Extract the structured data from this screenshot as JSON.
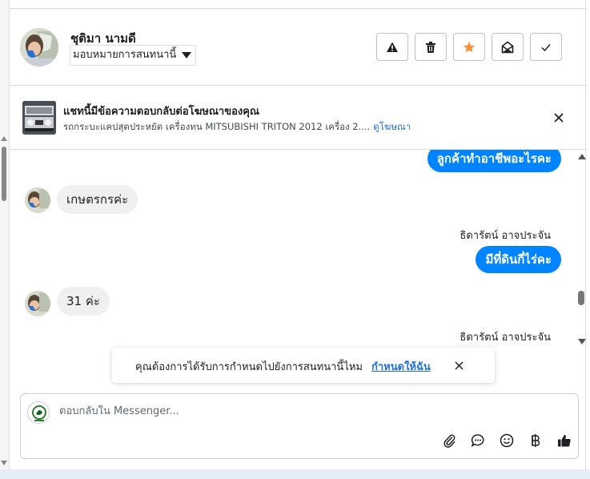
{
  "header": {
    "contact_name": "ชุติมา นามดี",
    "assign_label": "มอบหมายการสนทนานี้",
    "actions": [
      {
        "name": "report-spam",
        "icon": "warning-icon"
      },
      {
        "name": "delete",
        "icon": "trash-icon"
      },
      {
        "name": "star",
        "icon": "star-icon",
        "color": "#f7923b"
      },
      {
        "name": "mark-unread",
        "icon": "envelope-open-icon"
      },
      {
        "name": "mark-done",
        "icon": "check-icon"
      }
    ]
  },
  "ad": {
    "title": "แชทนี้มีข้อความตอบกลับต่อโฆษณาของคุณ",
    "description": "รถกระบะแคปสุดประหยัด เครื่องทน MITSUBISHI TRITON 2012 เครื่อง 2....",
    "link": "ดูโฆษณา"
  },
  "messages": [
    {
      "direction": "out",
      "text": "ลูกค้าทำอาชีพอะไรคะ"
    },
    {
      "direction": "in",
      "text": "เกษตรกรค่ะ"
    },
    {
      "direction": "out",
      "sender": "ธิดารัตน์ อาจประจัน",
      "text": "มีที่ดินกี่ไร่คะ"
    },
    {
      "direction": "in",
      "text": "31 ค่ะ"
    },
    {
      "direction": "out",
      "sender": "ธิดารัตน์ อาจประจัน",
      "text": ""
    }
  ],
  "toast": {
    "text": "คุณต้องการได้รับการกำหนดไปยังการสนทนานี้ไหม",
    "link": "กำหนดให้ฉัน"
  },
  "composer": {
    "placeholder": "ตอบกลับใน Messenger...",
    "tools": [
      "paperclip-icon",
      "chat-bubble-icon",
      "emoji-icon",
      "baht-icon",
      "thumbs-up-icon"
    ]
  },
  "colors": {
    "accent": "#0084ff",
    "link": "#216fdb",
    "star": "#f7923b"
  }
}
